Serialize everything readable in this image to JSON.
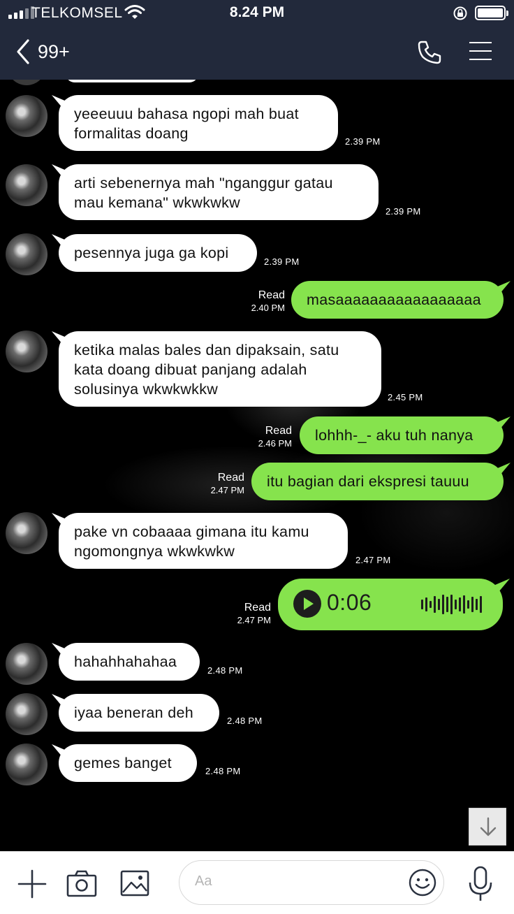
{
  "status_bar": {
    "carrier": "TELKOMSEL",
    "time": "8.24 PM",
    "icons": [
      "signal-icon",
      "wifi-icon",
      "rotation-lock-icon",
      "battery-icon"
    ]
  },
  "header": {
    "back_count": "99+",
    "icons": [
      "back-chevron-icon",
      "phone-icon",
      "menu-icon"
    ]
  },
  "messages": [
    {
      "dir": "in",
      "text": "yeeeuuu bahasa ngopi mah buat formalitas doang",
      "time": "2.39 PM"
    },
    {
      "dir": "in",
      "text": "arti sebenernya mah \"nganggur gatau mau kemana\" wkwkwkw",
      "time": "2.39 PM"
    },
    {
      "dir": "in",
      "text": "pesennya juga ga kopi",
      "time": "2.39 PM"
    },
    {
      "dir": "out",
      "text": "masaaaaaaaaaaaaaaaaa",
      "read": "Read",
      "time": "2.40 PM"
    },
    {
      "dir": "in",
      "text": "ketika malas bales dan dipaksain, satu kata doang dibuat panjang adalah solusinya wkwkwkkw",
      "time": "2.45 PM"
    },
    {
      "dir": "out",
      "text": "lohhh-_- aku tuh nanya",
      "read": "Read",
      "time": "2.46 PM"
    },
    {
      "dir": "out",
      "text": "itu bagian dari ekspresi tauuu",
      "read": "Read",
      "time": "2.47 PM"
    },
    {
      "dir": "in",
      "text": "pake vn cobaaaa gimana itu kamu ngomongnya wkwkwkw",
      "time": "2.47 PM"
    },
    {
      "dir": "out",
      "type": "voice",
      "duration": "0:06",
      "read": "Read",
      "time": "2.47 PM"
    },
    {
      "dir": "in",
      "text": "hahahhahahaa",
      "time": "2.48 PM"
    },
    {
      "dir": "in",
      "text": "iyaa beneran deh",
      "time": "2.48 PM"
    },
    {
      "dir": "in",
      "text": "gemes banget",
      "time": "2.48 PM"
    }
  ],
  "composer": {
    "placeholder": "Aa",
    "icons": [
      "plus-icon",
      "camera-icon",
      "image-icon",
      "emoji-icon",
      "microphone-icon"
    ]
  },
  "scroll_down": {
    "icon": "arrow-down-icon"
  },
  "colors": {
    "header_bg": "#22293b",
    "outgoing_bubble": "#86e34d",
    "incoming_bubble": "#ffffff",
    "chat_bg": "#000000"
  }
}
